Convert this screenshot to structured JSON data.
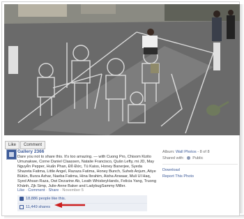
{
  "photo_actions": {
    "like": "Like",
    "comment": "Comment"
  },
  "post": {
    "author": "Gallery 2366",
    "text": "Dare you not to share this. It's too amazing. — with Cuong Pro, Chisom Kizito Umunakwe, Corne Daniel Claassen, Natalie Francisco, Quân Lefty, mi JD, May Nguyễn Pepper, Huấn Phan, Đỗ Đức, Tú Kaiss, Honey Banerjee, Syeda Shazeta Fatima, Little Angel, Razaza Fatima, Honey Bunch, Suheb Anjum, Atiye Bütün, Burza Azhar, Naeba Fatima, Hina Ibrahim, Aisha Anwaar, Muli Ul Haq, Syed Ahsan Raza, Owi Dezarine Ab, Leath WhiskeyHands, Felicia Yang, Truong Khánh, Zjk Simp, Julie-Anne Baker and LadybugSammy Miller.",
    "meta": {
      "like": "Like",
      "comment": "Comment",
      "share": "Share",
      "date": "November 5"
    },
    "likes": "18,886 people like this.",
    "shares": "11,449 shares"
  },
  "sidebar": {
    "album_label": "Album:",
    "album_name": "Wall Photos",
    "album_position": "- 8 of 8",
    "shared_with_label": "Shared with:",
    "shared_with_value": "Public",
    "download": "Download",
    "report": "Report This Photo"
  },
  "colors": {
    "link": "#3b5998",
    "arrow": "#cc1f1f",
    "likes_bg": "#eceff5"
  }
}
